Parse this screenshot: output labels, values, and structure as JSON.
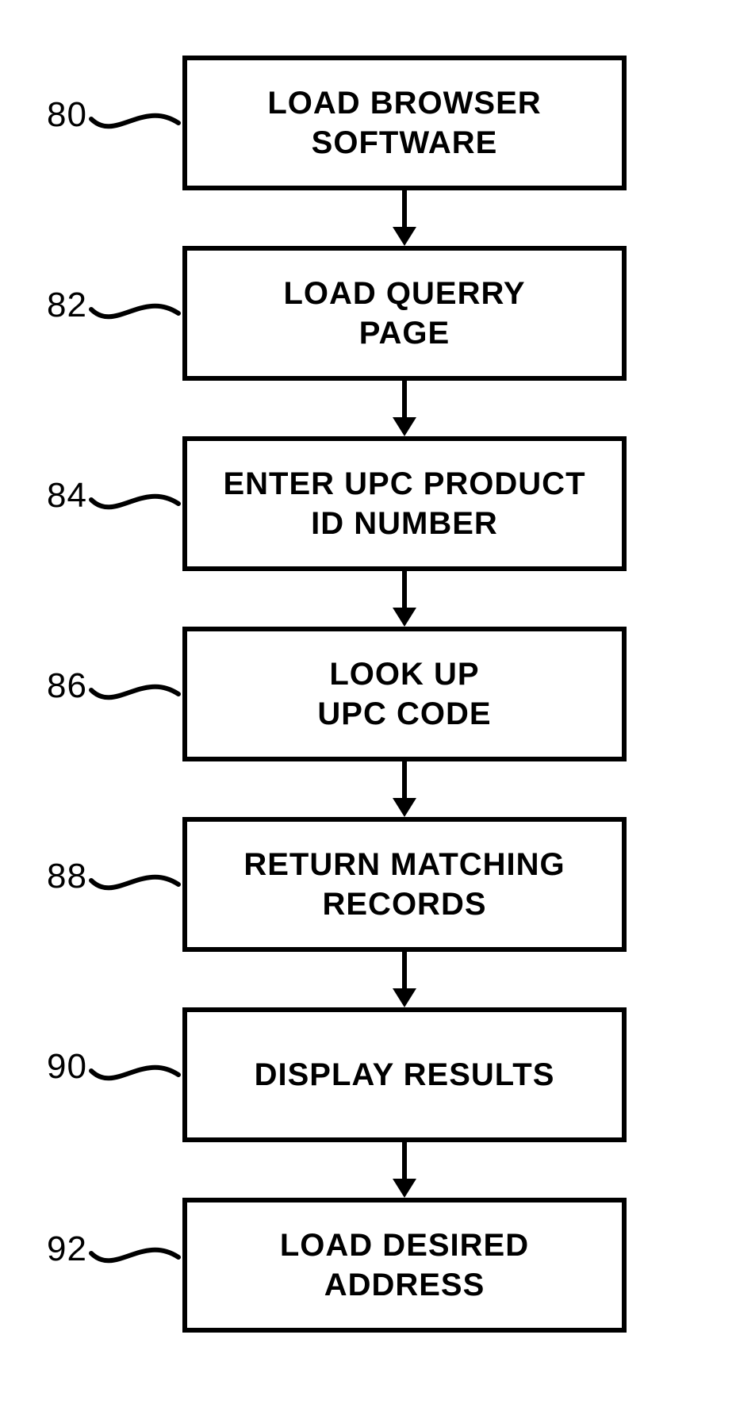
{
  "type": "flowchart",
  "direction": "top-to-bottom",
  "steps": [
    {
      "id": "80",
      "label": "80",
      "text_line1": "LOAD BROWSER",
      "text_line2": "SOFTWARE"
    },
    {
      "id": "82",
      "label": "82",
      "text_line1": "LOAD QUERRY",
      "text_line2": "PAGE"
    },
    {
      "id": "84",
      "label": "84",
      "text_line1": "ENTER UPC PRODUCT",
      "text_line2": "ID NUMBER"
    },
    {
      "id": "86",
      "label": "86",
      "text_line1": "LOOK UP",
      "text_line2": "UPC CODE"
    },
    {
      "id": "88",
      "label": "88",
      "text_line1": "RETURN MATCHING",
      "text_line2": "RECORDS"
    },
    {
      "id": "90",
      "label": "90",
      "text_line1": "DISPLAY  RESULTS",
      "text_line2": ""
    },
    {
      "id": "92",
      "label": "92",
      "text_line1": "LOAD DESIRED",
      "text_line2": "ADDRESS"
    }
  ]
}
